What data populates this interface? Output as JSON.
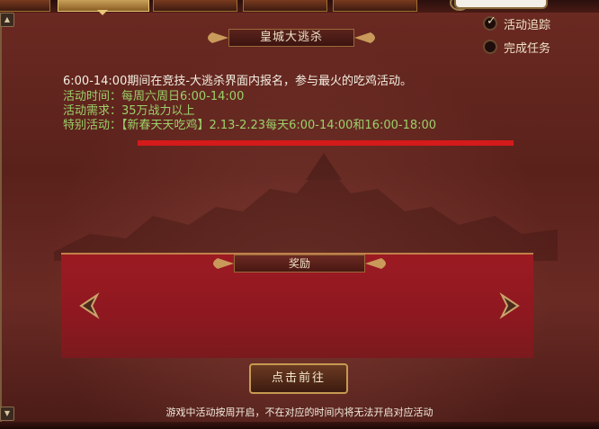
{
  "tabs": [
    {
      "label": "",
      "active": false
    },
    {
      "label": "",
      "active": true
    },
    {
      "label": "",
      "active": false
    },
    {
      "label": "",
      "active": false
    },
    {
      "label": "",
      "active": false
    }
  ],
  "event": {
    "title": "皇城大逃杀",
    "description": "6:00-14:00期间在竞技-大逃杀界面内报名，参与最火的吃鸡活动。",
    "time_line": "活动时间：每周六周日6:00-14:00",
    "requirement_line": "活动需求：35万战力以上",
    "special_line": "特别活动：【新春天天吃鸡】2.13-2.23每天6:00-14:00和16:00-18:00"
  },
  "options": {
    "track": {
      "label": "活动追踪",
      "checked": true
    },
    "complete": {
      "label": "完成任务",
      "checked": false
    }
  },
  "rewards": {
    "title": "奖励"
  },
  "go_button": {
    "label": "点击前往"
  },
  "footer_note": "游戏中活动按周开启，不在对应的时间内将无法开启对应活动",
  "colors": {
    "highlight_green": "#9bd16a",
    "underline_red": "#d41a1a",
    "panel_red": "#9c1a22"
  }
}
